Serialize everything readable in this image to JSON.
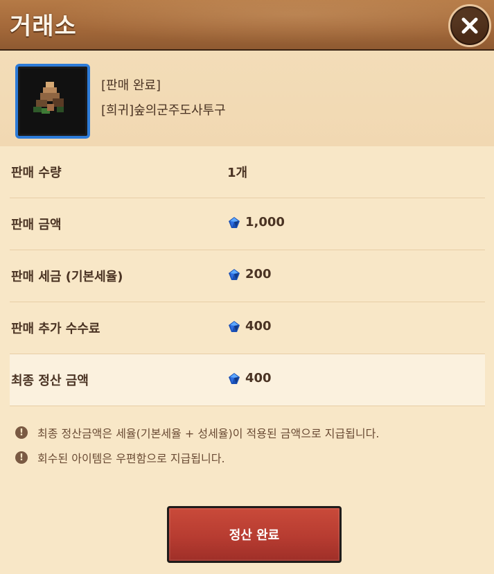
{
  "header": {
    "title": "거래소"
  },
  "item": {
    "status": "[판매 완료]",
    "name": "[희귀]숲의군주도사투구"
  },
  "rows": [
    {
      "label": "판매 수량",
      "value": "1개",
      "has_gem": false
    },
    {
      "label": "판매 금액",
      "value": "1,000",
      "has_gem": true
    },
    {
      "label": "판매 세금 (기본세율)",
      "value": "200",
      "has_gem": true
    },
    {
      "label": "판매 추가 수수료",
      "value": "400",
      "has_gem": true
    },
    {
      "label": "최종 정산 금액",
      "value": "400",
      "has_gem": true
    }
  ],
  "notes": [
    "최종 정산금액은 세율(기본세율 + 성세율)이 적용된 금액으로 지급됩니다.",
    "회수된 아이템은 우편함으로 지급됩니다."
  ],
  "confirm_button": {
    "label": "정산 완료"
  },
  "icons": {
    "close": "close-icon",
    "gem": "gem-currency-icon",
    "info": "exclamation-icon",
    "item": "helmet-item-icon"
  },
  "colors": {
    "header": "#a4693a",
    "background": "#f8e7c7",
    "text": "#4a3323",
    "button": "#b73c31",
    "item_border": "#2d7bd8"
  }
}
